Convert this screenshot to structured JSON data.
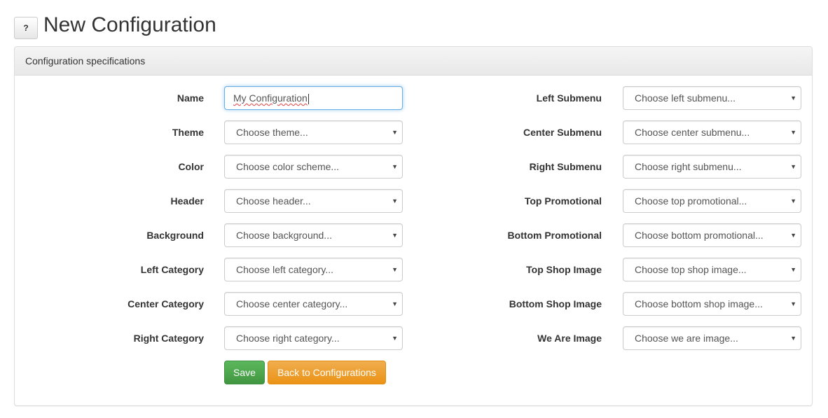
{
  "header": {
    "help_label": "?",
    "title": "New Configuration"
  },
  "panel": {
    "heading": "Configuration specifications"
  },
  "form": {
    "left": [
      {
        "label": "Name",
        "value": "My Configuration",
        "kind": "input"
      },
      {
        "label": "Theme",
        "placeholder": "Choose theme...",
        "kind": "select"
      },
      {
        "label": "Color",
        "placeholder": "Choose color scheme...",
        "kind": "select"
      },
      {
        "label": "Header",
        "placeholder": "Choose header...",
        "kind": "select"
      },
      {
        "label": "Background",
        "placeholder": "Choose background...",
        "kind": "select"
      },
      {
        "label": "Left Category",
        "placeholder": "Choose left category...",
        "kind": "select"
      },
      {
        "label": "Center Category",
        "placeholder": "Choose center category...",
        "kind": "select"
      },
      {
        "label": "Right Category",
        "placeholder": "Choose right category...",
        "kind": "select"
      }
    ],
    "right": [
      {
        "label": "Left Submenu",
        "placeholder": "Choose left submenu...",
        "kind": "select"
      },
      {
        "label": "Center Submenu",
        "placeholder": "Choose center submenu...",
        "kind": "select"
      },
      {
        "label": "Right Submenu",
        "placeholder": "Choose right submenu...",
        "kind": "select"
      },
      {
        "label": "Top Promotional",
        "placeholder": "Choose top promotional...",
        "kind": "select"
      },
      {
        "label": "Bottom Promotional",
        "placeholder": "Choose bottom promotional...",
        "kind": "select"
      },
      {
        "label": "Top Shop Image",
        "placeholder": "Choose top shop image...",
        "kind": "select"
      },
      {
        "label": "Bottom Shop Image",
        "placeholder": "Choose bottom shop image...",
        "kind": "select"
      },
      {
        "label": "We Are Image",
        "placeholder": "Choose we are image...",
        "kind": "select"
      }
    ],
    "caret_icon": "▼"
  },
  "actions": {
    "save_label": "Save",
    "back_label": "Back to Configurations"
  },
  "colors": {
    "save": "#5cb85c",
    "back": "#f0ad4e",
    "focus": "#66afe9"
  }
}
